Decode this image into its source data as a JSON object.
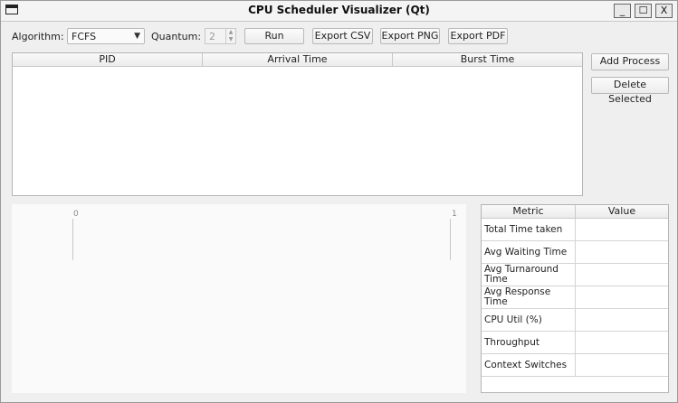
{
  "window": {
    "title": "CPU Scheduler Visualizer (Qt)",
    "min": "_",
    "max": "☐",
    "close": "X"
  },
  "toolbar": {
    "algorithm_label": "Algorithm:",
    "algorithm_value": "FCFS",
    "quantum_label": "Quantum:",
    "quantum_value": "2",
    "run": "Run",
    "export_csv": "Export CSV",
    "export_png": "Export PNG",
    "export_pdf": "Export PDF"
  },
  "process_table": {
    "columns": [
      "PID",
      "Arrival Time",
      "Burst Time"
    ],
    "rows": []
  },
  "side": {
    "add_process": "Add Process",
    "delete_selected": "Delete Selected"
  },
  "gantt": {
    "ticks": [
      "0",
      "1"
    ]
  },
  "metrics": {
    "columns": [
      "Metric",
      "Value"
    ],
    "rows": [
      {
        "name": "Total Time taken",
        "value": ""
      },
      {
        "name": "Avg Waiting Time",
        "value": ""
      },
      {
        "name": "Avg Turnaround Time",
        "value": ""
      },
      {
        "name": "Avg Response Time",
        "value": ""
      },
      {
        "name": "CPU Util (%)",
        "value": ""
      },
      {
        "name": "Throughput",
        "value": ""
      },
      {
        "name": "Context Switches",
        "value": ""
      }
    ]
  }
}
